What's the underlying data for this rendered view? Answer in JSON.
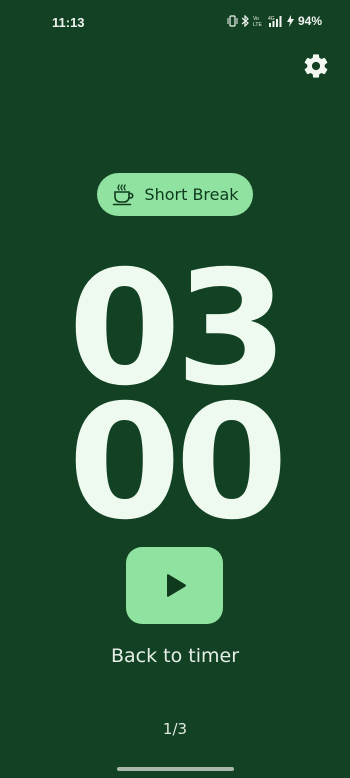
{
  "status_bar": {
    "time": "11:13",
    "battery": "94%",
    "icons": [
      "vibrate-icon",
      "bluetooth-icon",
      "volte-icon",
      "4g-signal-icon",
      "charging-icon"
    ]
  },
  "settings": {
    "icon": "gear-icon"
  },
  "mode": {
    "label": "Short Break",
    "icon": "coffee-cup-icon"
  },
  "timer": {
    "minutes": "03",
    "seconds": "00"
  },
  "play": {
    "icon": "play-icon"
  },
  "back_link": "Back to timer",
  "page_indicator": "1/3",
  "colors": {
    "background": "#134123",
    "accent": "#8fe29f",
    "digits": "#eefaf0"
  }
}
